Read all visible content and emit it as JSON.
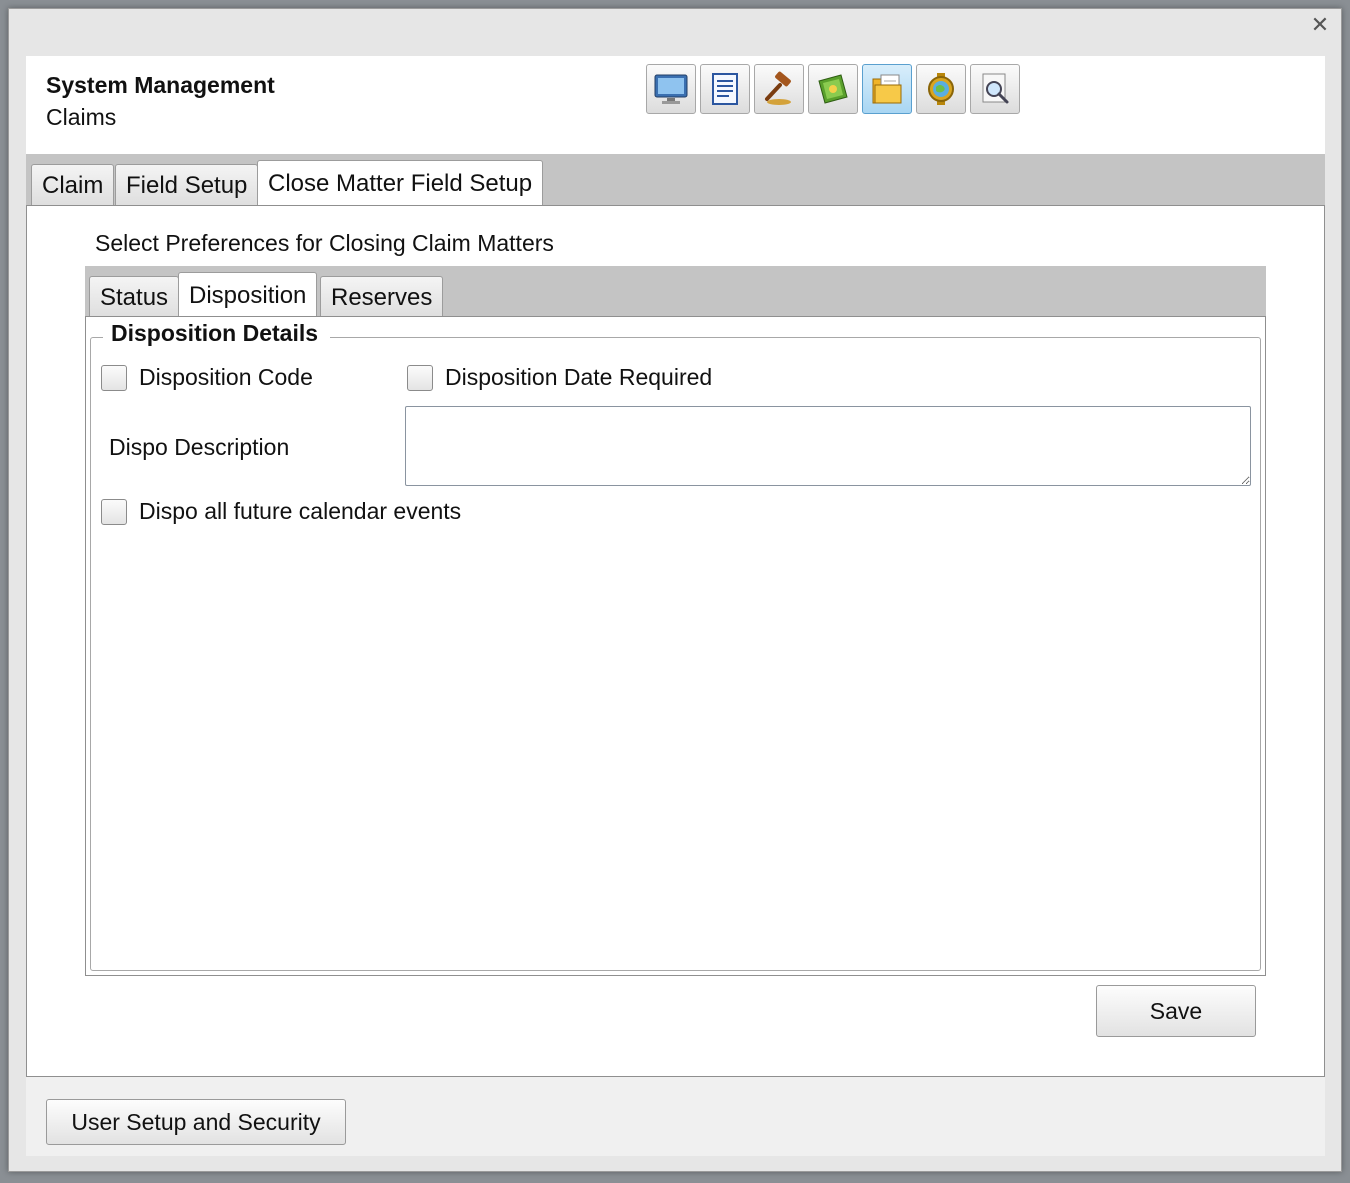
{
  "window": {
    "close_glyph": "✕"
  },
  "header": {
    "title": "System Management",
    "subtitle": "Claims"
  },
  "toolbar": {
    "buttons": [
      {
        "icon": "monitor-icon",
        "active": false
      },
      {
        "icon": "document-icon",
        "active": false
      },
      {
        "icon": "gavel-icon",
        "active": false
      },
      {
        "icon": "green-book-icon",
        "active": false
      },
      {
        "icon": "folder-icon",
        "active": true
      },
      {
        "icon": "globe-icon",
        "active": false
      },
      {
        "icon": "magnifier-document-icon",
        "active": false
      }
    ]
  },
  "outer_tabs": [
    {
      "label": "Claim",
      "selected": false
    },
    {
      "label": "Field Setup",
      "selected": false
    },
    {
      "label": "Close Matter Field Setup",
      "selected": true
    }
  ],
  "close_matter": {
    "prefs_label": "Select Preferences for Closing Claim Matters",
    "inner_tabs": [
      {
        "label": "Status",
        "selected": false
      },
      {
        "label": "Disposition",
        "selected": true
      },
      {
        "label": "Reserves",
        "selected": false
      }
    ],
    "disposition": {
      "legend": "Disposition Details",
      "code_label": "Disposition Code",
      "code_checked": false,
      "date_required_label": "Disposition Date Required",
      "date_required_checked": false,
      "description_label": "Dispo Description",
      "description_value": "",
      "future_events_label": "Dispo all future calendar events",
      "future_events_checked": false
    },
    "save_label": "Save"
  },
  "footer": {
    "user_setup_label": "User Setup and Security"
  },
  "colors": {
    "tabstrip": "#c4c4c4",
    "active_toolbar": "#a9d6f3",
    "border": "#8f8f8f"
  }
}
